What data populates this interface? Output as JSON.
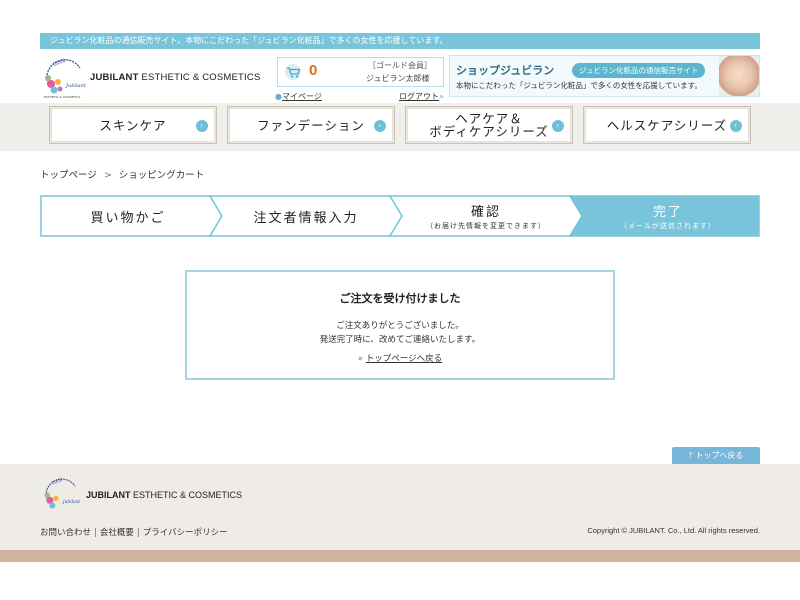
{
  "header": {
    "notice": "ジュビラン化粧品の通信販売サイト。本物にこだわった「ジュビラン化粧品」で多くの女性を応援しています。",
    "brand_bold": "JUBILANT",
    "brand_rest": " ESTHETIC & COSMETICS",
    "cart_count": "0",
    "member_rank": "［ゴールド会員］",
    "member_name": "ジュビラン太郎様",
    "mypage_label": "マイページ",
    "logout_label": "ログアウト",
    "banner": {
      "title": "ショップジュビラン",
      "tag": "ジュビラン化粧品の通信販売サイト",
      "desc": "本物にこだわった「ジュビラン化粧品」で多くの女性を応援しています。"
    }
  },
  "nav": {
    "items": [
      {
        "label": "スキンケア"
      },
      {
        "label": "ファンデーション"
      },
      {
        "label_line1": "ヘアケア＆",
        "label_line2": "ボディケアシリーズ"
      },
      {
        "label": "ヘルスケアシリーズ"
      }
    ]
  },
  "breadcrumb": {
    "home": "トップページ",
    "sep": ">",
    "current": "ショッピングカート"
  },
  "steps": [
    {
      "label": "買い物かご",
      "sub": ""
    },
    {
      "label": "注文者情報入力",
      "sub": ""
    },
    {
      "label": "確認",
      "sub": "（お届け先情報を変更できます）"
    },
    {
      "label": "完了",
      "sub": "（メールが送信されます）"
    }
  ],
  "steps_active_index": 3,
  "colors": {
    "step_active": "#78c4da",
    "step_inactive": "#ffffff",
    "step_border": "#78c4da",
    "accent": "#78c4da",
    "cart_count": "#e86a1c"
  },
  "completion": {
    "title": "ご注文を受け付けました",
    "message1": "ご注文ありがとうございました。",
    "message2": "発送完了時に、改めてご連絡いたします。",
    "link_prefix": "»",
    "link_label": "トップページへ戻る"
  },
  "pagetop_label": "トップへ戻る",
  "footer": {
    "brand_bold": "JUBILANT",
    "brand_rest": " ESTHETIC & COSMETICS",
    "links": [
      "お問い合わせ",
      "会社概要",
      "プライバシーポリシー"
    ],
    "separator": "|",
    "copyright": "Copyright © JUBILANT. Co., Ltd. All rights reserved."
  }
}
